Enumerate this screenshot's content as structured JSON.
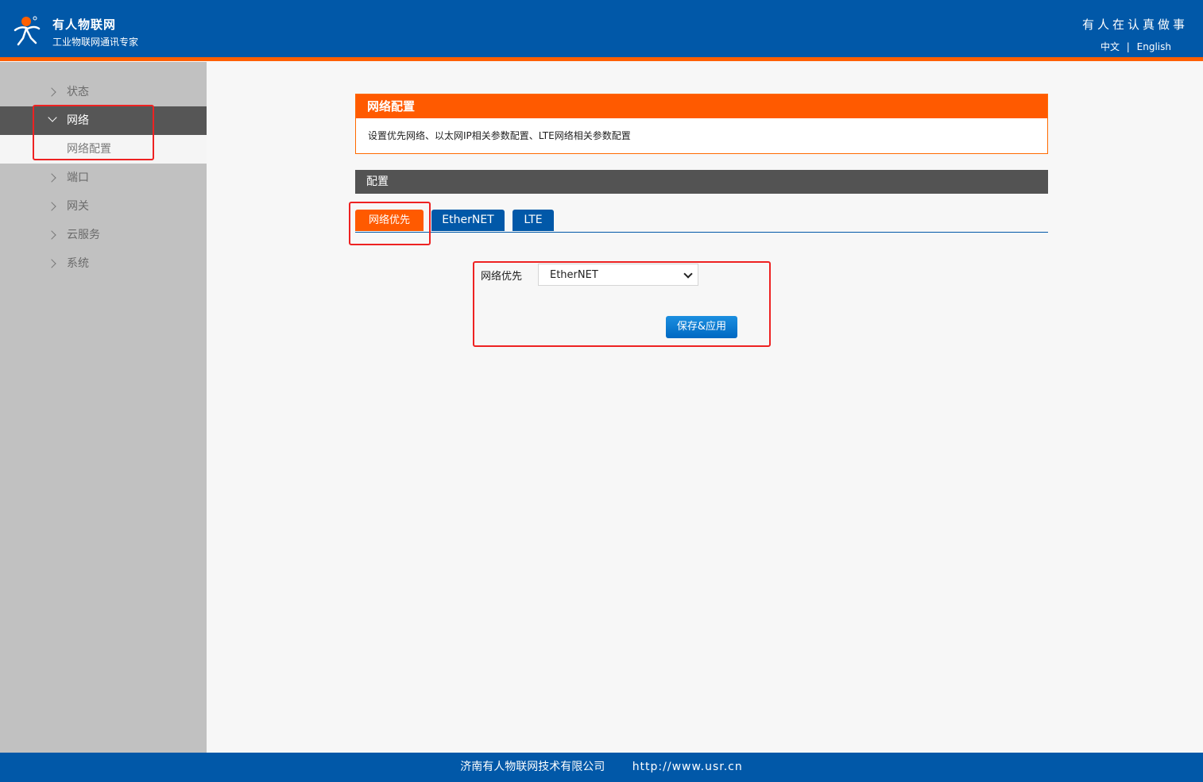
{
  "header": {
    "brand_name": "有人物联网",
    "brand_sub": "工业物联网通讯专家",
    "slogan": "有人在认真做事",
    "lang_cn": "中文",
    "lang_sep": "|",
    "lang_en": "English",
    "logo_icon": "usr-logo-icon"
  },
  "sidebar": {
    "items": [
      {
        "label": "状态"
      },
      {
        "label": "网络",
        "active": true
      },
      {
        "label": "网络配置",
        "sub": true
      },
      {
        "label": "端口"
      },
      {
        "label": "网关"
      },
      {
        "label": "云服务"
      },
      {
        "label": "系统"
      }
    ]
  },
  "info": {
    "title": "网络配置",
    "desc": "设置优先网络、以太网IP相关参数配置、LTE网络相关参数配置"
  },
  "config": {
    "title": "配置",
    "tabs": [
      {
        "label": "网络优先",
        "active": true
      },
      {
        "label": "EtherNET"
      },
      {
        "label": "LTE"
      }
    ],
    "form": {
      "label": "网络优先",
      "value": "EtherNET",
      "save_label": "保存&应用"
    }
  },
  "colors": {
    "primary": "#0158a8",
    "accent": "#ff5a00",
    "annotation": "#ee2222"
  },
  "footer": {
    "company": "济南有人物联网技术有限公司",
    "url": "http://www.usr.cn"
  }
}
